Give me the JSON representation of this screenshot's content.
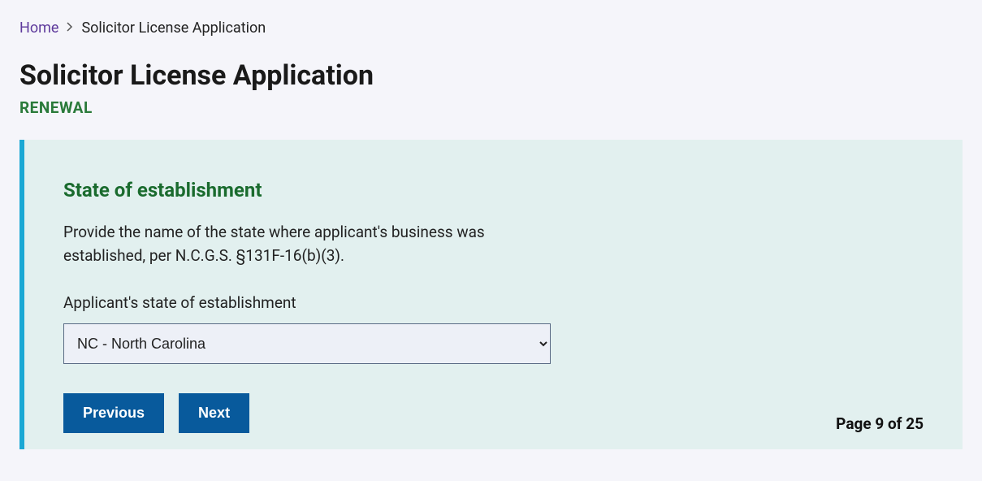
{
  "breadcrumb": {
    "home": "Home",
    "current": "Solicitor License Application"
  },
  "header": {
    "title": "Solicitor License Application",
    "subtitle": "RENEWAL"
  },
  "panel": {
    "section_title": "State of establishment",
    "description": "Provide the name of the state where applicant's business was established, per N.C.G.S. §131F-16(b)(3).",
    "field_label": "Applicant's state of establishment",
    "select_value": "NC - North Carolina",
    "previous_label": "Previous",
    "next_label": "Next",
    "page_indicator": "Page 9 of 25"
  }
}
